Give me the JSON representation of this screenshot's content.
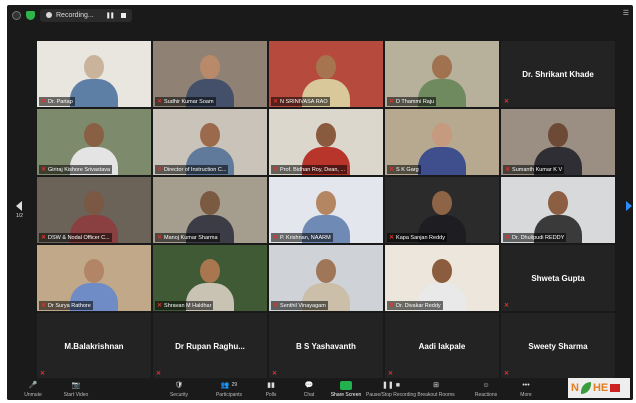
{
  "topbar": {
    "recording_label": "Recording...",
    "pause_glyph": "❚❚",
    "view_glyph": "☰",
    "view_label": "View"
  },
  "pagination": {
    "prev_label": "1/2",
    "next_label": "1/2"
  },
  "tiles": [
    {
      "name": "Dr. Partap",
      "video": true,
      "scheme": [
        "#e9e6df",
        "#c9b39b",
        "#5d7fa6"
      ]
    },
    {
      "name": "Sudhir Kumar Soam",
      "video": true,
      "scheme": [
        "#8f8275",
        "#b88a6a",
        "#44506a"
      ]
    },
    {
      "name": "N SRINIVASA RAO",
      "video": true,
      "scheme": [
        "#b64a3c",
        "#a6744f",
        "#d9c89a"
      ]
    },
    {
      "name": "D Thammi Raju",
      "video": true,
      "active": true,
      "scheme": [
        "#b7b19c",
        "#a07250",
        "#6f8a5f"
      ]
    },
    {
      "name": "Dr. Shrikant Khade",
      "video": false
    },
    {
      "name": "Giriraj Kishore Srivastava",
      "video": true,
      "scheme": [
        "#7e8a6c",
        "#8a6044",
        "#e4e4e4"
      ]
    },
    {
      "name": "Director of Instruction C...",
      "video": true,
      "scheme": [
        "#c9c3b9",
        "#9b6a4c",
        "#5f7a9a"
      ]
    },
    {
      "name": "Prof. Bidhan Roy, Dean, ...",
      "video": true,
      "scheme": [
        "#dcd7cd",
        "#8a5a3e",
        "#b8352b"
      ]
    },
    {
      "name": "S K Garg",
      "video": true,
      "scheme": [
        "#b7a98f",
        "#c59a7e",
        "#3f4e8c"
      ]
    },
    {
      "name": "Sumanth Kumar K V",
      "video": true,
      "scheme": [
        "#9a8f82",
        "#6c4a36",
        "#2e2e34"
      ]
    },
    {
      "name": "DSW & Nodal Officer C...",
      "video": true,
      "scheme": [
        "#6c6358",
        "#7a5844",
        "#8a4040"
      ]
    },
    {
      "name": "Manoj Kumar Sharma",
      "video": true,
      "scheme": [
        "#a59e8f",
        "#7b5a42",
        "#3c3c46"
      ]
    },
    {
      "name": "P. Krishnan, NAARM",
      "video": true,
      "scheme": [
        "#e3e6ec",
        "#b48662",
        "#6f8bb5"
      ]
    },
    {
      "name": "Kapa Sanjan Reddy",
      "video": true,
      "scheme": [
        "#2b2b2b",
        "#8e6447",
        "#1e1e22"
      ]
    },
    {
      "name": "Dr. Dhulipudi REDDY",
      "video": true,
      "scheme": [
        "#d8d9db",
        "#8c5e42",
        "#3a3a3a"
      ]
    },
    {
      "name": "Dr Surya Rathore",
      "video": true,
      "scheme": [
        "#c0a888",
        "#b28566",
        "#6f8cc7"
      ]
    },
    {
      "name": "Shravan M Haldhar",
      "video": true,
      "scheme": [
        "#3f5a35",
        "#a9774f",
        "#c9c3b4"
      ]
    },
    {
      "name": "Senthil Vinayagam",
      "video": true,
      "scheme": [
        "#cfd3d8",
        "#9f7758",
        "#cbbfa9"
      ]
    },
    {
      "name": "Dr. Divakar Reddy",
      "video": true,
      "scheme": [
        "#ece6dc",
        "#8b5c3d",
        "#e9e9e9"
      ]
    },
    {
      "name": "Shweta Gupta",
      "video": false
    },
    {
      "name": "M.Balakrishnan",
      "video": false
    },
    {
      "name": "Dr Rupan Raghu...",
      "video": false
    },
    {
      "name": "B S Yashavanth",
      "video": false
    },
    {
      "name": "Aadi lakpale",
      "video": false
    },
    {
      "name": "Sweety Sharma",
      "video": false
    }
  ],
  "toolbar": {
    "items": [
      {
        "key": "unmute",
        "label": "Unmute",
        "glyph": "🎤"
      },
      {
        "key": "start_video",
        "label": "Start Video",
        "glyph": "📷"
      },
      {
        "key": "security",
        "label": "Security",
        "glyph": "🛡"
      },
      {
        "key": "participants",
        "label": "Participants",
        "glyph": "👥",
        "count": "29"
      },
      {
        "key": "polls",
        "label": "Polls",
        "glyph": "▮▮"
      },
      {
        "key": "chat",
        "label": "Chat",
        "glyph": "💬"
      },
      {
        "key": "share_screen",
        "label": "Share Screen",
        "glyph": ""
      },
      {
        "key": "pause_stop_recording",
        "label": "Pause/Stop Recording",
        "glyph": "❚❚ ■"
      },
      {
        "key": "breakout_rooms",
        "label": "Breakout Rooms",
        "glyph": "⊞"
      },
      {
        "key": "reactions",
        "label": "Reactions",
        "glyph": "☺"
      },
      {
        "key": "more",
        "label": "More",
        "glyph": "•••"
      }
    ]
  },
  "logo": {
    "text": "N",
    "suffix": "HE"
  },
  "colors": {
    "window_bg": "#1a1a1a",
    "active_speaker": "#a6d447",
    "muted_red": "#e0322b",
    "share_green": "#22b14c",
    "nav_blue": "#2d8cff"
  }
}
